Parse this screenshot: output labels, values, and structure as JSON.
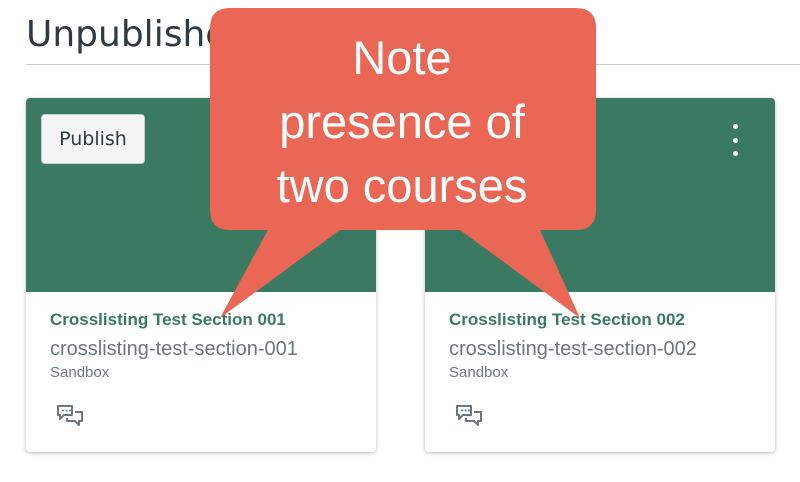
{
  "section": {
    "title": "Unpublished Courses"
  },
  "cards": [
    {
      "publish_label": "Publish",
      "course_name": "Crosslisting Test Section 001",
      "course_code": "crosslisting-test-section-001",
      "term": "Sandbox",
      "header_color": "#3a7a62",
      "icons": {
        "options": "kebab-menu-icon",
        "discussions": "discussions-icon"
      }
    },
    {
      "course_name": "Crosslisting Test Section 002",
      "course_code": "crosslisting-test-section-002",
      "term": "Sandbox",
      "header_color": "#3a7a62",
      "icons": {
        "options": "kebab-menu-icon",
        "discussions": "discussions-icon"
      }
    }
  ],
  "annotation": {
    "lines": [
      "Note",
      "presence of",
      "two courses"
    ],
    "color": "#ea6655"
  }
}
